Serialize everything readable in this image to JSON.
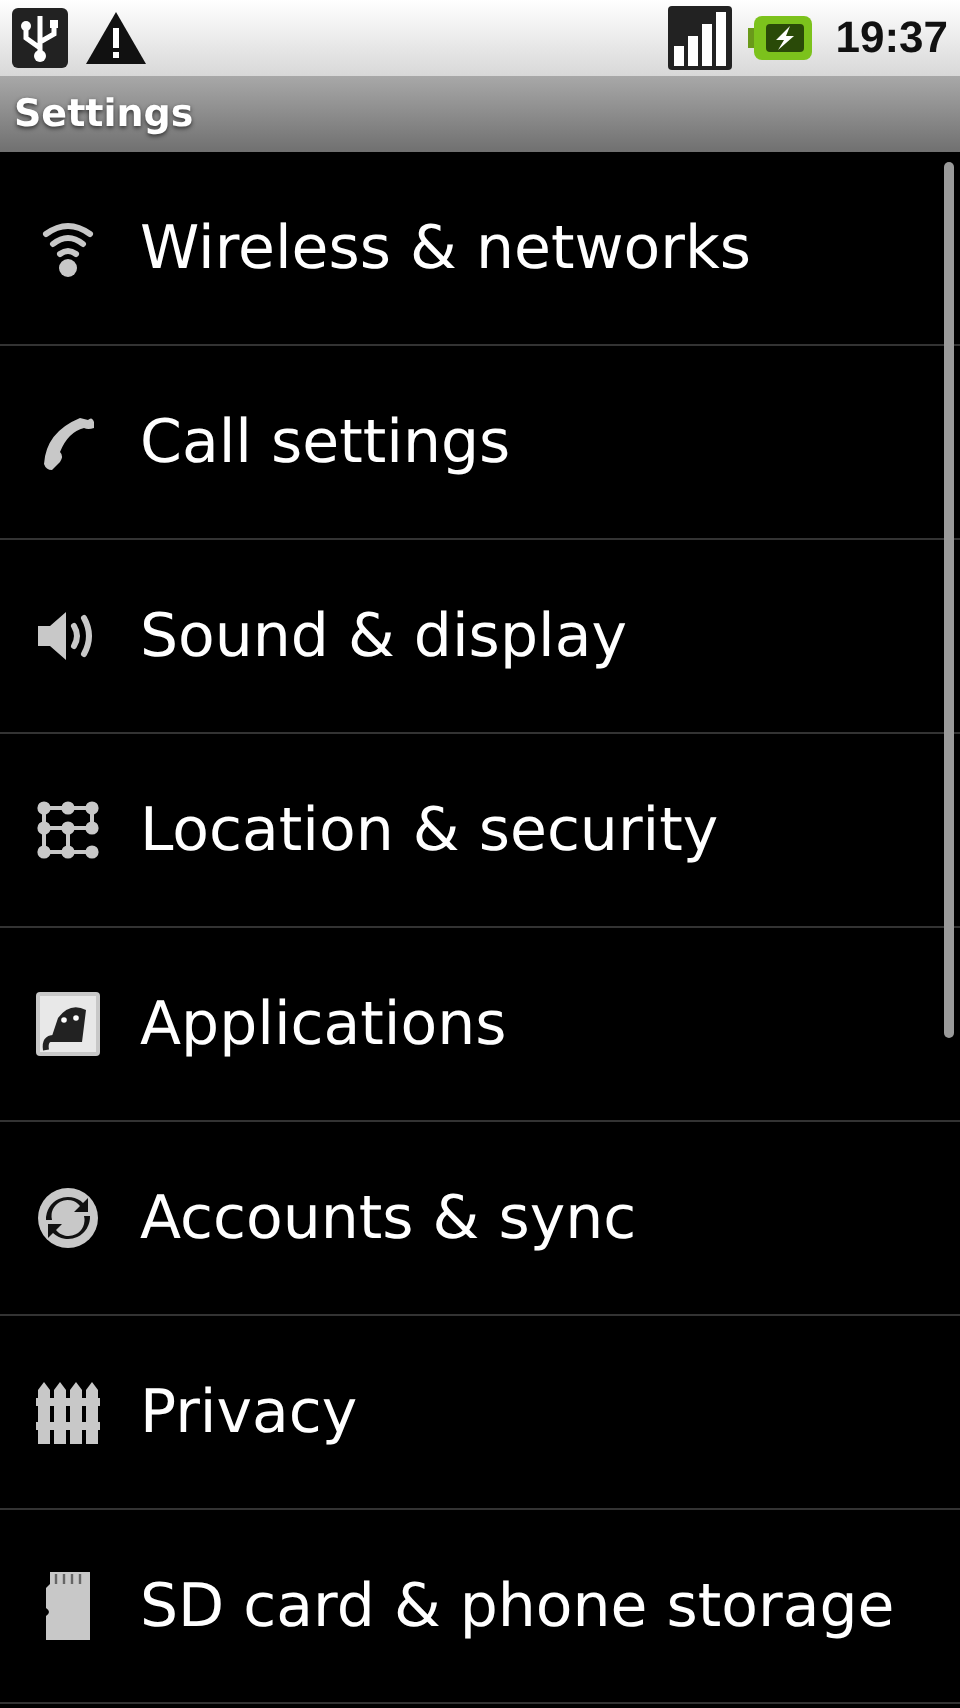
{
  "status_bar": {
    "time": "19:37"
  },
  "title_bar": {
    "title": "Settings"
  },
  "items": [
    {
      "label": "Wireless & networks"
    },
    {
      "label": "Call settings"
    },
    {
      "label": "Sound & display"
    },
    {
      "label": "Location & security"
    },
    {
      "label": "Applications"
    },
    {
      "label": "Accounts & sync"
    },
    {
      "label": "Privacy"
    },
    {
      "label": "SD card & phone storage"
    }
  ]
}
